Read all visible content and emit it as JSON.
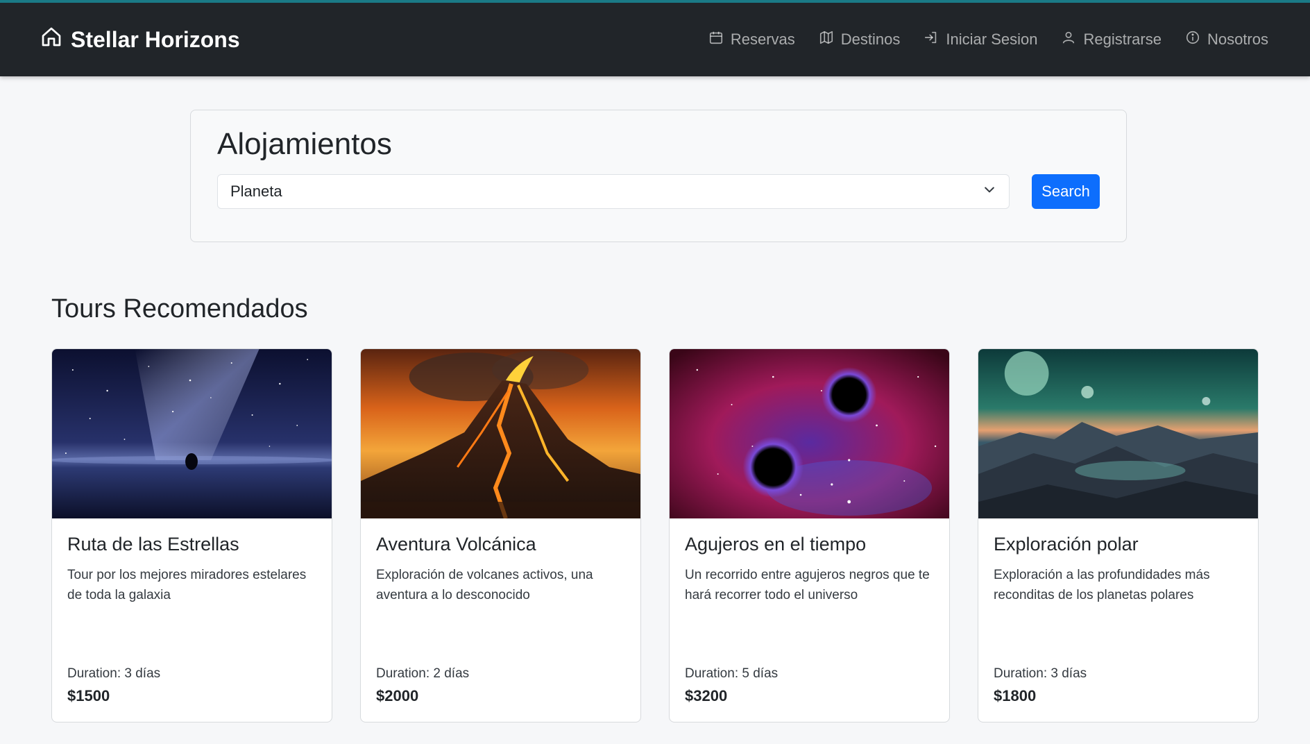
{
  "header": {
    "brand": "Stellar Horizons",
    "brand_icon": "home-icon",
    "nav": [
      {
        "label": "Reservas",
        "icon": "calendar-icon"
      },
      {
        "label": "Destinos",
        "icon": "map-icon"
      },
      {
        "label": "Iniciar Sesion",
        "icon": "login-icon"
      },
      {
        "label": "Registrarse",
        "icon": "user-icon"
      },
      {
        "label": "Nosotros",
        "icon": "info-icon"
      }
    ]
  },
  "search": {
    "title": "Alojamientos",
    "select_value": "Planeta",
    "button_label": "Search"
  },
  "tours": {
    "title": "Tours Recomendados",
    "items": [
      {
        "title": "Ruta de las Estrellas",
        "description": "Tour por los mejores miradores estelares de toda la galaxia",
        "duration": "Duration: 3 días",
        "price": "$1500",
        "image": "starry-night-lake-image"
      },
      {
        "title": "Aventura Volcánica",
        "description": "Exploración de volcanes activos, una aventura a lo desconocido",
        "duration": "Duration: 2 días",
        "price": "$2000",
        "image": "erupting-volcano-image"
      },
      {
        "title": "Agujeros en el tiempo",
        "description": "Un recorrido entre agujeros negros que te hará recorrer todo el universo",
        "duration": "Duration: 5 días",
        "price": "$3200",
        "image": "black-holes-nebula-image"
      },
      {
        "title": "Exploración polar",
        "description": "Exploración a las profundidades más reconditas de los planetas polares",
        "duration": "Duration: 3 días",
        "price": "$1800",
        "image": "polar-planet-landscape-image"
      }
    ]
  },
  "colors": {
    "navbar_bg": "#212529",
    "navbar_top_accent": "#1a7a86",
    "primary_button": "#0d6efd",
    "page_bg": "#f6f7f9"
  }
}
